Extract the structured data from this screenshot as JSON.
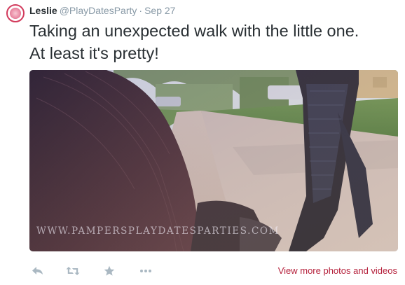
{
  "tweet": {
    "author_name": "Leslie",
    "author_handle": "@PlayDatesParty",
    "separator": "·",
    "date": "Sep 27",
    "text_line1": "Taking an unexpected walk with the little one.",
    "text_line2": "At least it's pretty!",
    "avatar_icon": "pink-circle-logo-icon"
  },
  "media": {
    "watermark": "WWW.PAMPERSPLAYDATESPARTIES.COM"
  },
  "actions": {
    "reply_icon": "reply-icon",
    "retweet_icon": "retweet-icon",
    "favorite_icon": "star-icon",
    "more_icon": "more-dots-icon",
    "view_more_label": "View more photos and videos"
  },
  "colors": {
    "text": "#292f33",
    "muted": "#8899a6",
    "action_icon": "#aab8c2",
    "view_more_link": "#b5203b",
    "avatar_ring": "#d23a5c"
  }
}
